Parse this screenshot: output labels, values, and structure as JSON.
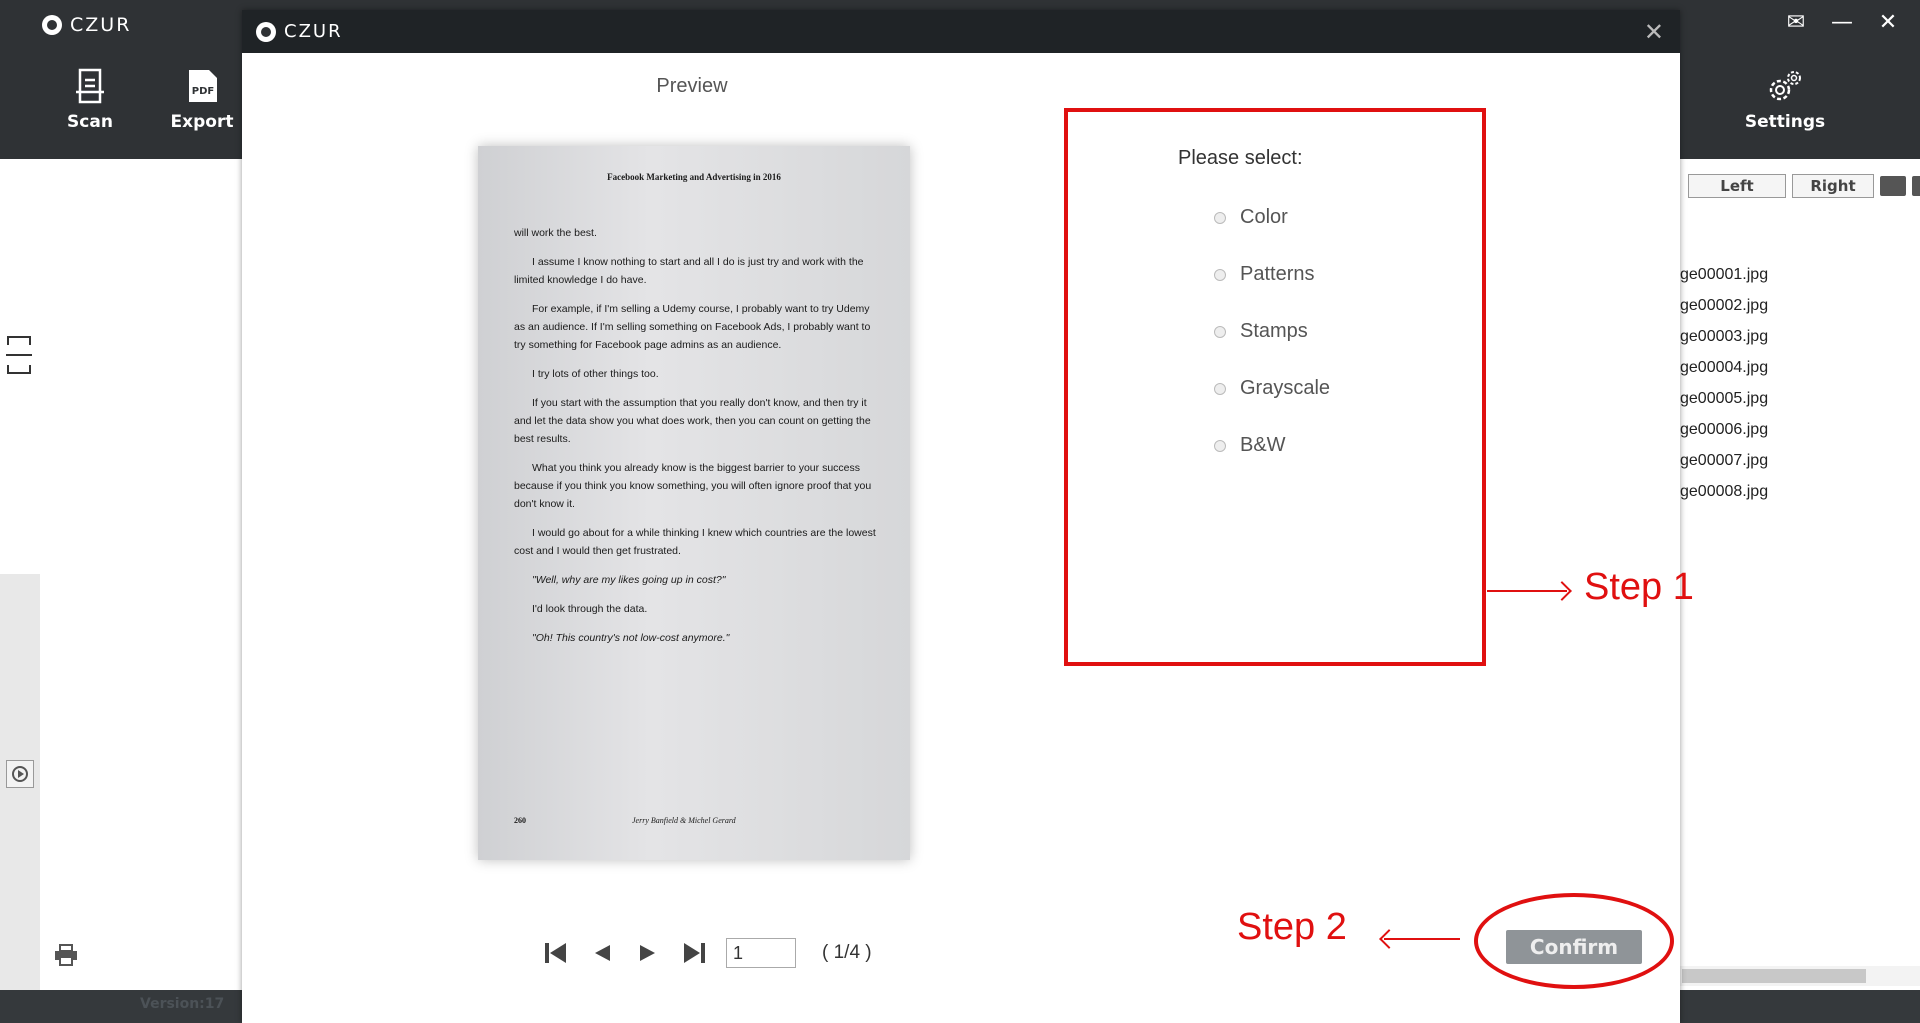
{
  "app": {
    "brand": "CZUR",
    "toolbar": {
      "scan_label": "Scan",
      "export_label": "Export",
      "settings_label": "Settings"
    },
    "controls": [
      "✉",
      "—",
      "✕"
    ],
    "version_label": "Version:17",
    "view_buttons": {
      "left": "Left",
      "right": "Right"
    },
    "files": [
      "ge00001.jpg",
      "ge00002.jpg",
      "ge00003.jpg",
      "ge00004.jpg",
      "ge00005.jpg",
      "ge00006.jpg",
      "ge00007.jpg",
      "ge00008.jpg"
    ]
  },
  "modal": {
    "brand": "CZUR",
    "close_glyph": "✕",
    "preview_title": "Preview",
    "page": {
      "header": "Facebook Marketing and Advertising in 2016",
      "paragraphs": [
        "will work the best.",
        "I assume I know nothing to start and all I do is just try and work with the limited knowledge I do have.",
        "For example, if I'm selling a Udemy course, I probably want to try Udemy as an audience. If I'm selling something on Facebook Ads, I probably want to try something for Facebook page admins as an audience.",
        "I try lots of other things too.",
        "If you start with the assumption that you really don't know, and then try it and let the data show you what does work, then you can count on getting the best results.",
        "What you think you already know is the biggest barrier to your success because if you think you know something, you will often ignore proof that you don't know it.",
        "I would go about for a while thinking I knew which countries are the lowest cost and I would then get frustrated.",
        "\"Well, why are my likes going up in cost?\"",
        "I'd look through the data.",
        "\"Oh! This country's not low-cost anymore.\""
      ],
      "footer_number": "260",
      "footer_author": "Jerry Banfield & Michel Gerard"
    },
    "select": {
      "title": "Please select:",
      "options": [
        "Color",
        "Patterns",
        "Stamps",
        "Grayscale",
        "B&W"
      ]
    },
    "pager": {
      "current": "1",
      "count": "( 1/4 )"
    },
    "confirm_label": "Confirm"
  },
  "annotations": {
    "step1": "Step 1",
    "step2": "Step 2"
  },
  "colors": {
    "titlebar": "#2f3235",
    "annotation_red": "#e01010",
    "confirm_bg": "#8f9498"
  }
}
